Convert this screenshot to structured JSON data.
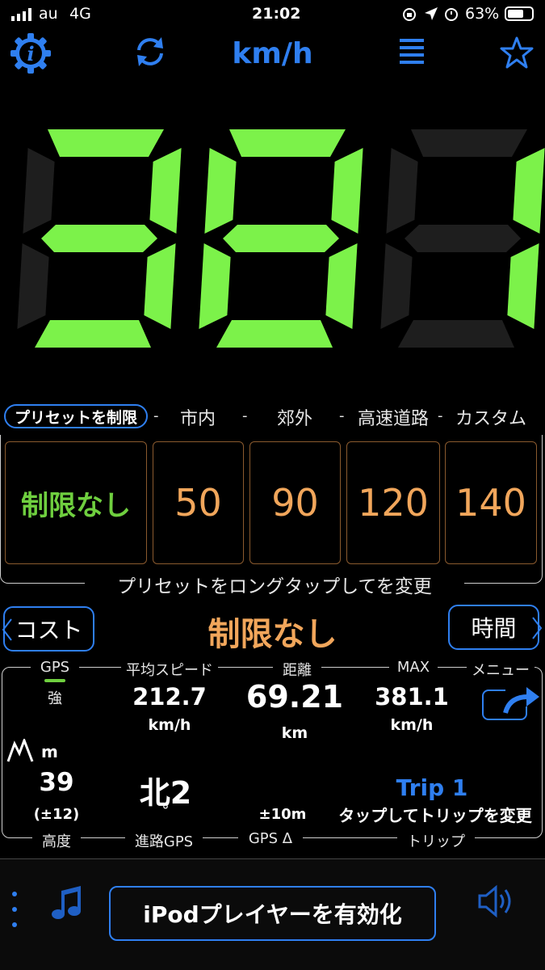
{
  "status_bar": {
    "carrier": "au",
    "network": "4G",
    "time": "21:02",
    "battery": "63%",
    "icons": [
      "signal-icon",
      "orientation-lock-icon",
      "location-arrow-icon",
      "alarm-icon",
      "battery-icon"
    ]
  },
  "header": {
    "title": "km/h",
    "icons": [
      "info-gear-icon",
      "refresh-icon",
      "menu-list-icon",
      "star-icon"
    ],
    "accent_color": "#2f7ff0"
  },
  "speed": {
    "digits": "381",
    "lit_color": "#7cf24a",
    "unlit_color": "#1e1e1e"
  },
  "presets": {
    "limit_button": "プリセットを制限",
    "tabs": [
      "市内",
      "郊外",
      "高速道路",
      "カスタム"
    ],
    "boxes": [
      "制限なし",
      "50",
      "90",
      "120",
      "140"
    ],
    "hint": "プリセットをロングタップしてを変更"
  },
  "mode": {
    "left_button": "コスト",
    "center_label": "制限なし",
    "right_button": "時間"
  },
  "stats": {
    "gps": {
      "label": "GPS",
      "strength": "強"
    },
    "avg_speed": {
      "label": "平均スピード",
      "value": "212.7",
      "unit": "km/h"
    },
    "distance": {
      "label": "距離",
      "value": "69.21",
      "unit": "km"
    },
    "max": {
      "label": "MAX",
      "value": "381.1",
      "unit": "km/h"
    },
    "menu": {
      "label": "メニュー"
    },
    "altitude": {
      "unit": "m",
      "value": "39",
      "accuracy": "(±12)",
      "label": "高度"
    },
    "heading": {
      "value": "北2",
      "unit": "°",
      "label": "進路GPS"
    },
    "gps_delta": {
      "value": "±10m",
      "label": "GPS Δ"
    },
    "trip": {
      "name": "Trip 1",
      "hint": "タップしてトリップを変更",
      "label": "トリップ"
    }
  },
  "player": {
    "button": "iPodプレイヤーを有効化",
    "icons": [
      "more-dots-icon",
      "music-note-icon",
      "speaker-icon"
    ]
  }
}
